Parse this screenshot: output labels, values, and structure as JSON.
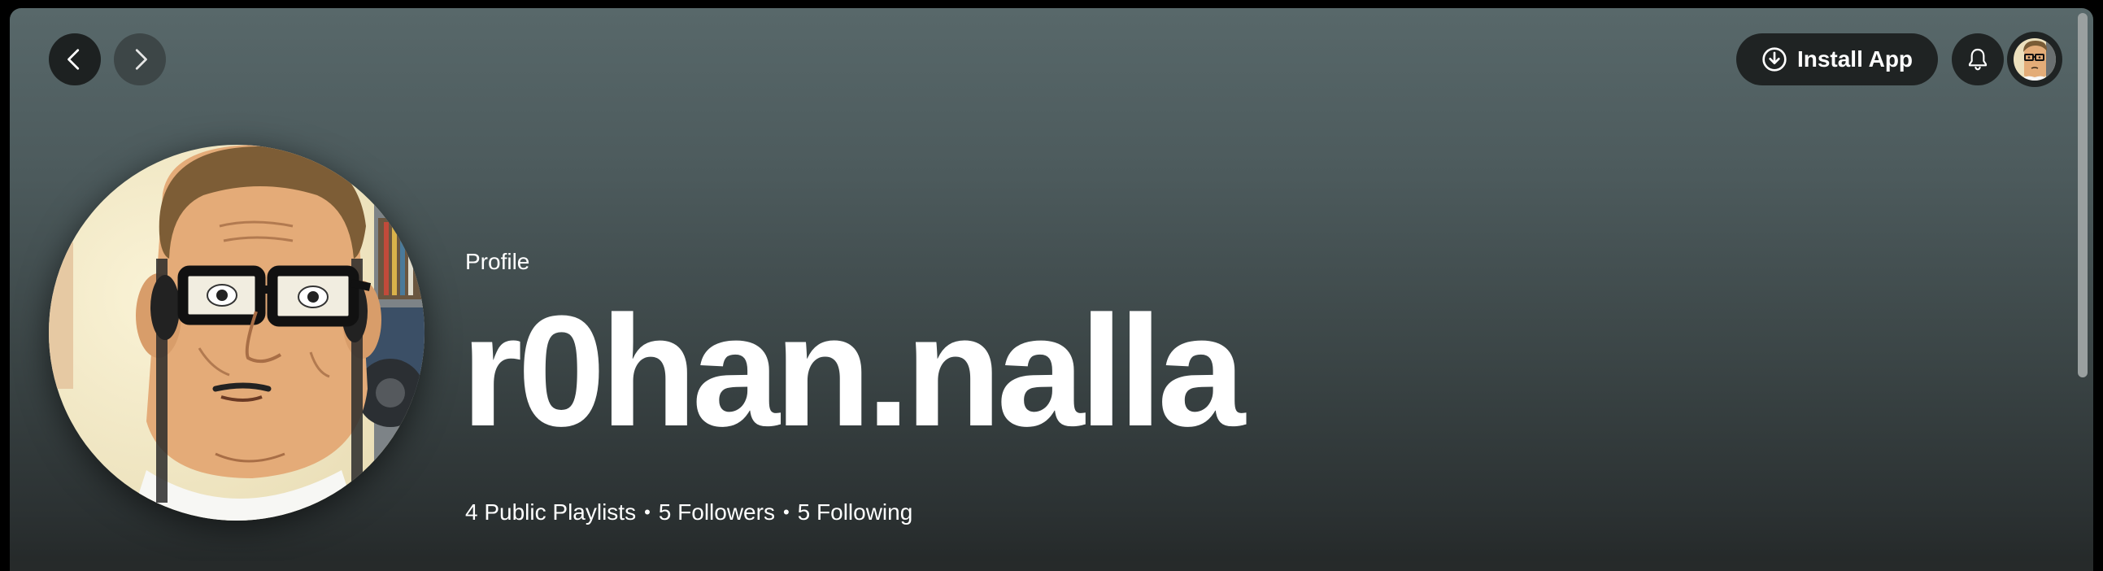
{
  "topbar": {
    "back_icon": "chevron-left-icon",
    "forward_icon": "chevron-right-icon",
    "install_label": "Install App",
    "install_icon": "download-circle-icon",
    "bell_icon": "bell-icon",
    "account_icon": "user-avatar"
  },
  "profile": {
    "type_label": "Profile",
    "name": "r0han.nalla",
    "stats": {
      "playlists": "4 Public Playlists",
      "followers": "5 Followers",
      "following": "5 Following",
      "separator": "•"
    }
  },
  "colors": {
    "header_top": "#58686a",
    "header_bottom": "#242828",
    "button_dark": "#1f2323",
    "text": "#ffffff"
  }
}
